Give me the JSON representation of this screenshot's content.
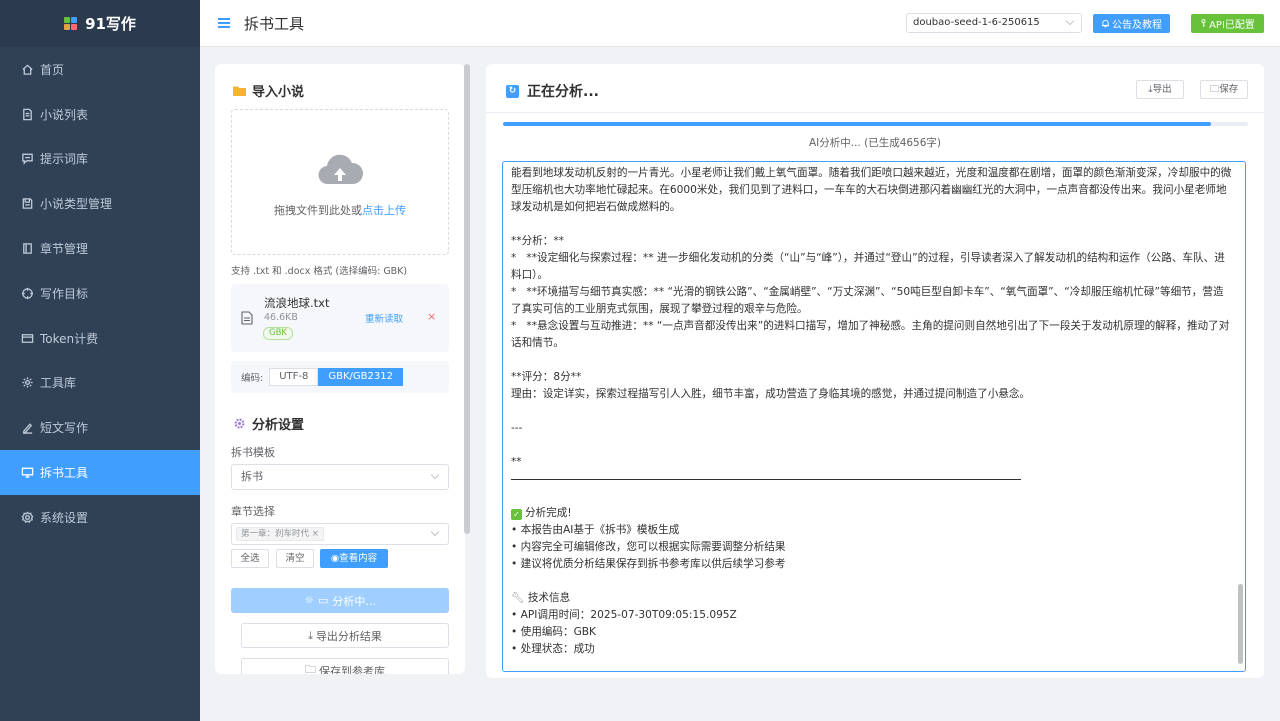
{
  "brand": {
    "name": "91写作"
  },
  "sidebar": {
    "items": [
      {
        "label": "首页",
        "icon": "home-icon"
      },
      {
        "label": "小说列表",
        "icon": "document-icon"
      },
      {
        "label": "提示词库",
        "icon": "chat-icon"
      },
      {
        "label": "小说类型管理",
        "icon": "save-icon"
      },
      {
        "label": "章节管理",
        "icon": "book-icon"
      },
      {
        "label": "写作目标",
        "icon": "target-icon"
      },
      {
        "label": "Token计费",
        "icon": "card-icon"
      },
      {
        "label": "工具库",
        "icon": "gear-icon"
      },
      {
        "label": "短文写作",
        "icon": "pen-icon"
      },
      {
        "label": "拆书工具",
        "icon": "monitor-icon",
        "active": true
      },
      {
        "label": "系统设置",
        "icon": "settings-icon"
      }
    ]
  },
  "header": {
    "title": "拆书工具",
    "model": "doubao-seed-1-6-250615",
    "notice_button": "公告及教程",
    "api_button": "API已配置"
  },
  "import": {
    "title": "导入小说",
    "drag_text": "拖拽文件到此处或",
    "click_upload": "点击上传",
    "support_text": "支持 .txt 和 .docx 格式 (选择编码: GBK)",
    "file": {
      "name": "流浪地球.txt",
      "size": "46.6KB",
      "tag": "GBK",
      "reload": "重新读取",
      "close": "×"
    },
    "encoding_label": "编码:",
    "encodings": [
      {
        "label": "UTF-8"
      },
      {
        "label": "GBK/GB2312",
        "selected": true
      }
    ]
  },
  "settings": {
    "title": "分析设置",
    "template_label": "拆书模板",
    "template_value": "拆书",
    "chapter_label": "章节选择",
    "chapter_chip": "第一章：刹车时代",
    "select_all": "全选",
    "clear": "清空",
    "view_content": "查看内容",
    "analyze_button": "分析中...",
    "export_button": "导出分析结果",
    "save_ref_button": "保存到参考库"
  },
  "result": {
    "title": "正在分析...",
    "export": "导出",
    "save": "保存",
    "progress_percent": 95,
    "progress_text": "AI分析中... (已生成4656字)",
    "lines": [
      "能看到地球发动机反射的一片青光。小星老师让我们戴上氧气面罩。随着我们距喷口越来越近，光度和温度都在剧增，面罩的颜色渐渐变深，冷却服中的微型压缩机也大功率地忙碌起来。在6000米处，我们见到了进料口，一车车的大石块倒进那闪着幽幽红光的大洞中，一点声音都没传出来。我问小星老师地球发动机是如何把岩石做成燃料的。",
      "",
      "**分析：**",
      "*   **设定细化与探索过程：** 进一步细化发动机的分类（“山”与“峰”），并通过“登山”的过程，引导读者深入了解发动机的结构和运作（公路、车队、进料口）。",
      "*   **环境描写与细节真实感：** “光滑的钢铁公路”、“金属峭壁”、“万丈深渊”、“50吨巨型自卸卡车”、“氧气面罩”、“冷却服压缩机忙碌”等细节，营造了真实可信的工业朋克式氛围，展现了攀登过程的艰辛与危险。",
      "*   **悬念设置与互动推进：** “一点声音都没传出来”的进料口描写，增加了神秘感。主角的提问则自然地引出了下一段关于发动机原理的解释，推动了对话和情节。",
      "",
      "**评分：8分**",
      "理由：设定详实，探索过程描写引人入胜，细节丰富，成功营造了身临其境的感觉，并通过提问制造了小悬念。",
      "",
      "---",
      "",
      "**"
    ],
    "complete_title": "分析完成!",
    "complete_lines": [
      "• 本报告由AI基于《拆书》模板生成",
      "• 内容完全可编辑修改，您可以根据实际需要调整分析结果",
      "• 建议将优质分析结果保存到拆书参考库以供后续学习参考"
    ],
    "tech_title": "技术信息",
    "tech_lines": [
      "• API调用时间：2025-07-30T09:05:15.095Z",
      "• 使用编码：GBK",
      "• 处理状态：成功"
    ]
  },
  "colors": {
    "sidebar_bg": "#304156",
    "accent": "#409eff",
    "success": "#67c23a"
  }
}
